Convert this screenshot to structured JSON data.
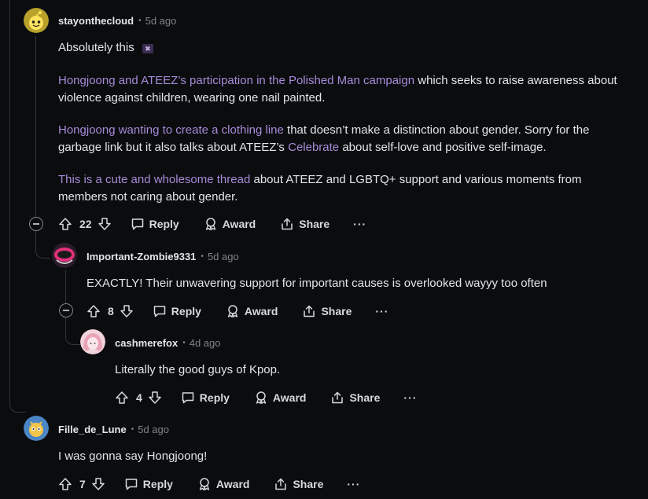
{
  "comments": [
    {
      "author": "stayonthecloud",
      "age": "5d ago",
      "paragraphs": [
        {
          "text": "Absolutely this",
          "emoji": "✖"
        },
        {
          "link": "Hongjoong and ATEEZ’s participation in the Polished Man campaign",
          "text": " which seeks to raise awareness about violence against children, wearing one nail painted."
        },
        {
          "link": "Hongjoong wanting to create a clothing line",
          "text_before_link2": " that doesn’t make a distinction about gender. Sorry for the garbage link but it also talks about ATEEZ’s ",
          "link2": "Celebrate",
          "text_after_link2": " about self-love and positive self-image."
        },
        {
          "link": "This is a cute and wholesome thread",
          "text": " about ATEEZ and LGBTQ+ support and various moments from members not caring about gender."
        }
      ],
      "votes": "22"
    },
    {
      "author": "Important-Zombie9331",
      "age": "5d ago",
      "text": "EXACTLY! Their unwavering support for important causes  is overlooked wayyy too often",
      "votes": "8"
    },
    {
      "author": "cashmerefox",
      "age": "4d ago",
      "text": "Literally the good guys of Kpop.",
      "votes": "4"
    },
    {
      "author": "Fille_de_Lune",
      "age": "5d ago",
      "text": "I was gonna say Hongjoong!",
      "votes": "7"
    }
  ],
  "actions": {
    "reply": "Reply",
    "award": "Award",
    "share": "Share",
    "more": "···"
  },
  "colors": {
    "background": "#0b0c0e",
    "link": "#a78bda",
    "text": "#e3e6e8",
    "muted": "#818384"
  }
}
